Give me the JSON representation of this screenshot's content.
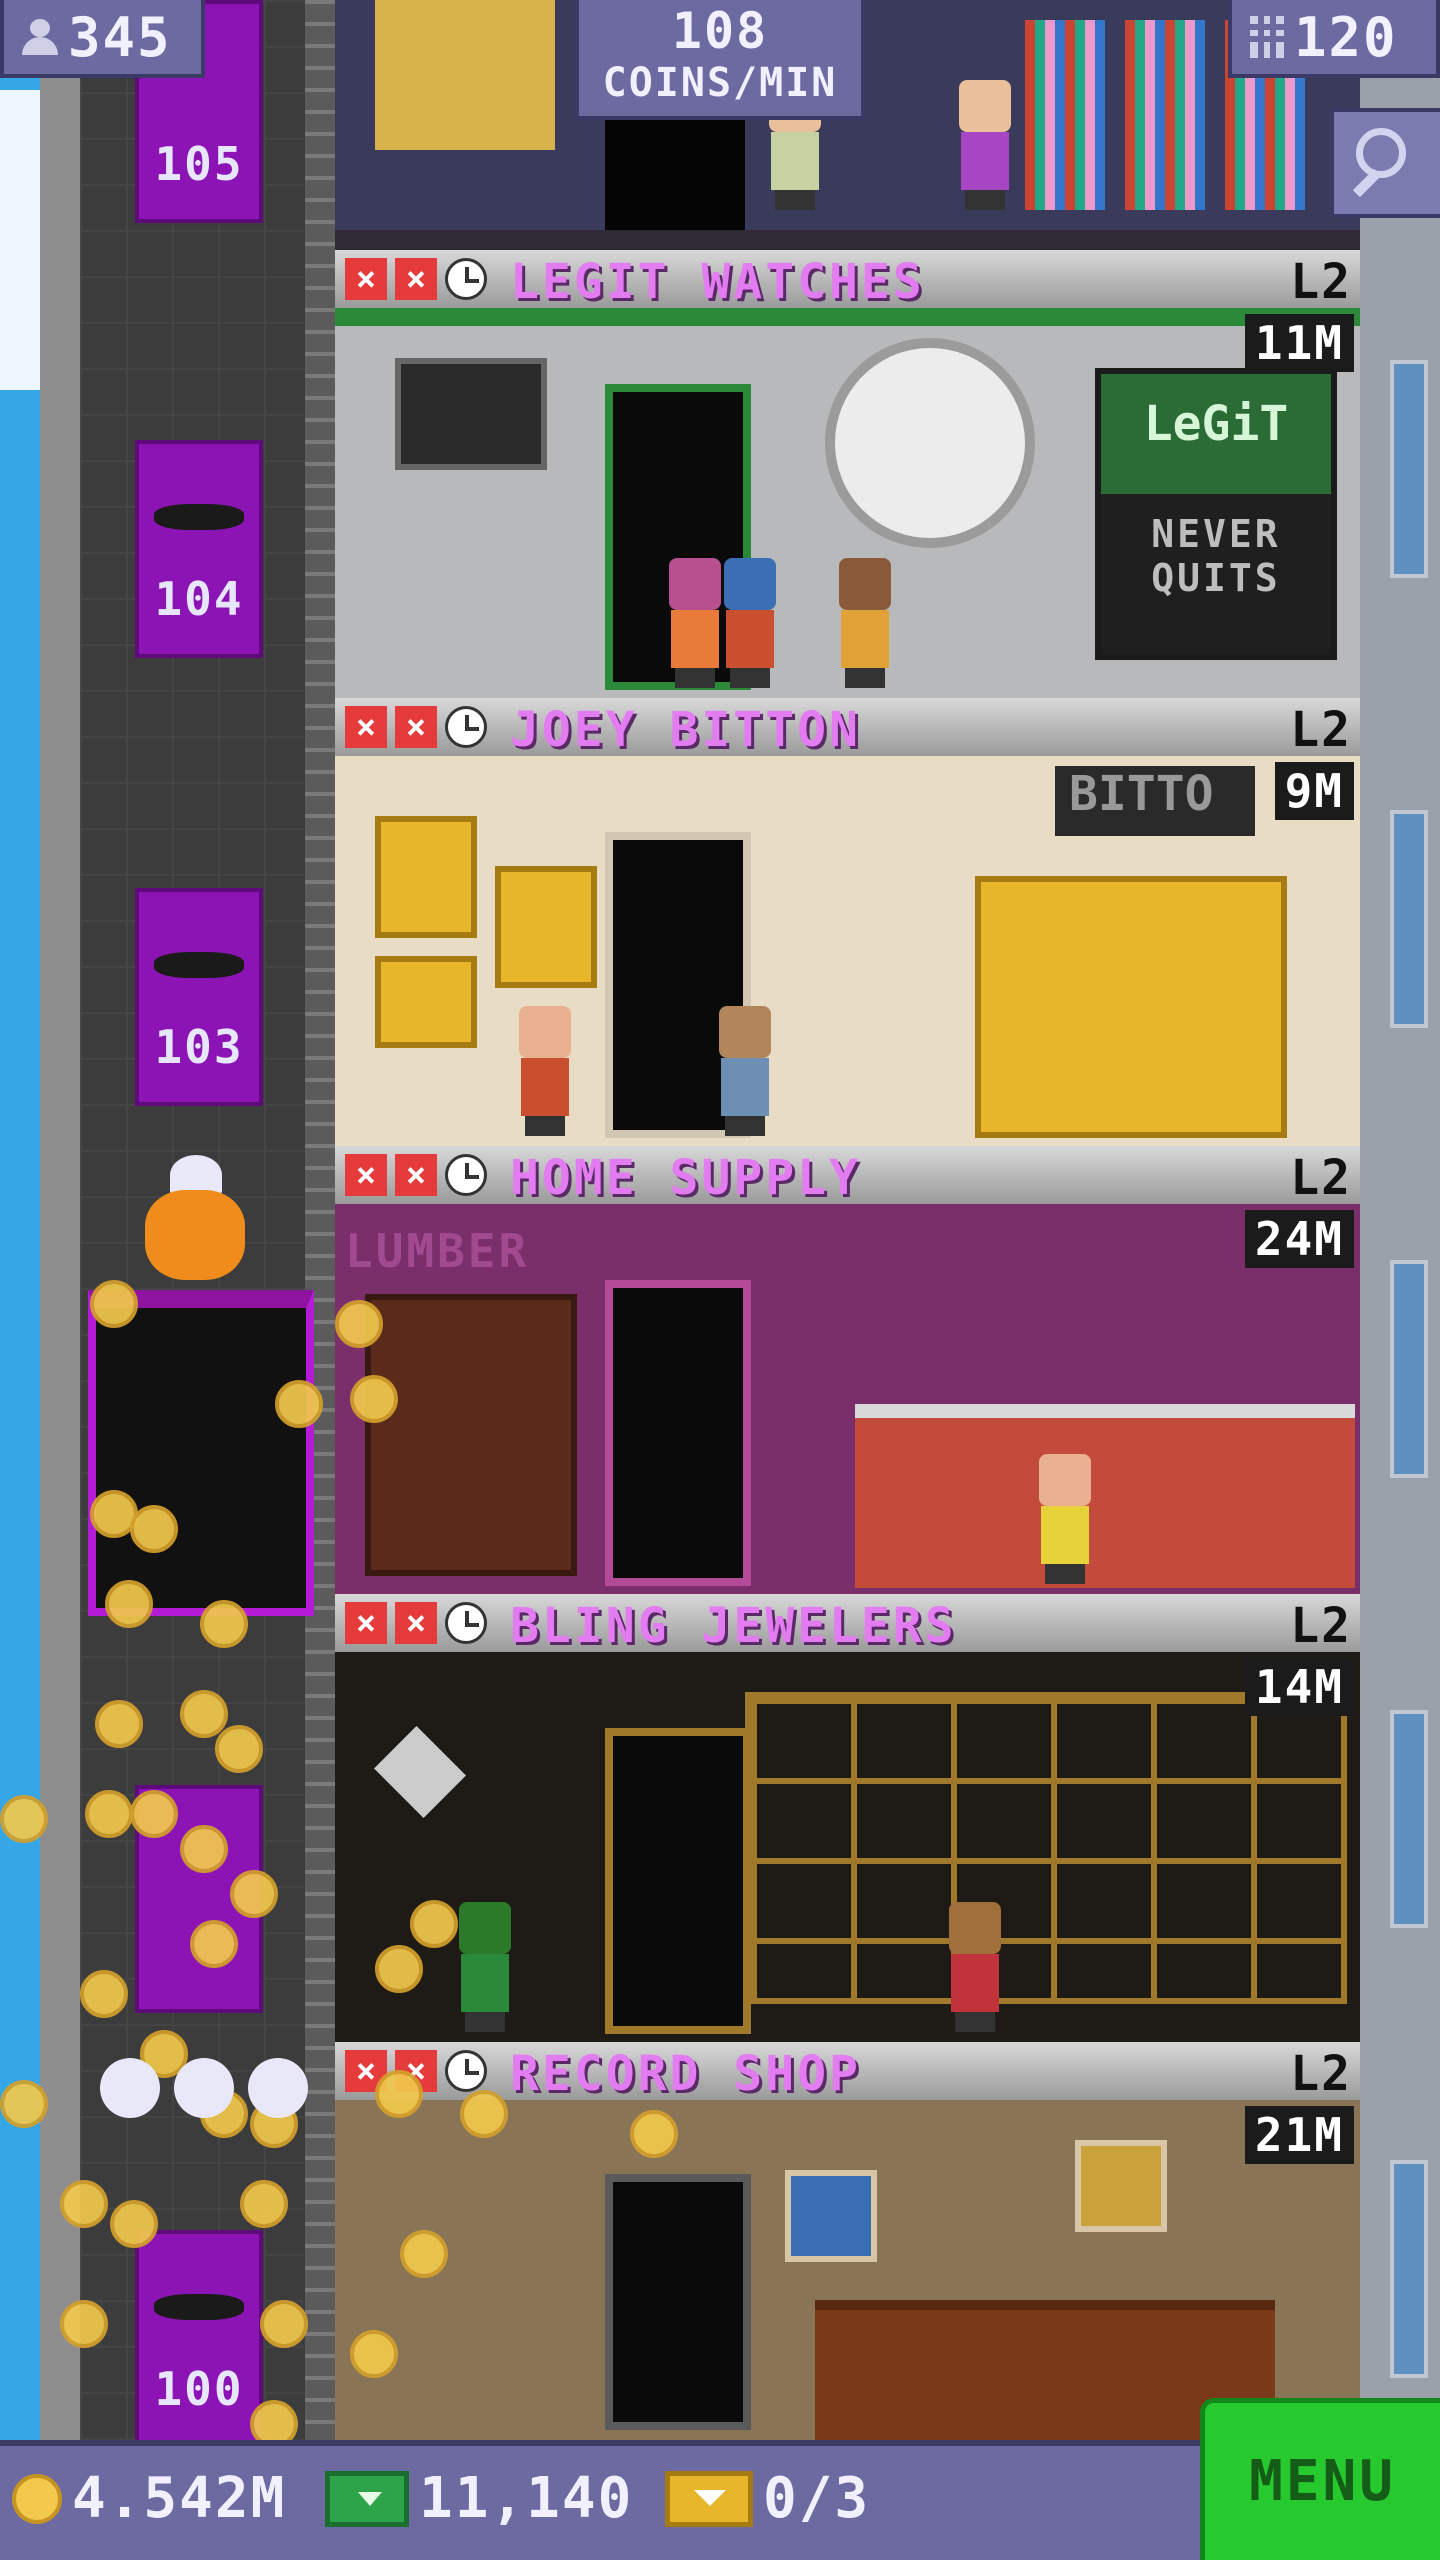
{
  "hud": {
    "population": "345",
    "coins_per_min_value": "108",
    "coins_per_min_unit": "COINS/MIN",
    "floor_count": "120",
    "zoom_icon": "magnifier-icon"
  },
  "elevator": {
    "floor_labels": [
      "105",
      "104",
      "103",
      "100"
    ]
  },
  "floors": [
    {
      "name": "LEGIT WATCHES",
      "level": "L2",
      "stock": "11M",
      "sign_line1": "LeGiT",
      "sign_line2": "NEVER",
      "sign_line3": "QUITS"
    },
    {
      "name": "JOEY BITTON",
      "level": "L2",
      "stock": "9M",
      "sign_line1": "BITTO"
    },
    {
      "name": "HOME SUPPLY",
      "level": "L2",
      "stock": "24M",
      "sign_line1": "LUMBER"
    },
    {
      "name": "BLING JEWELERS",
      "level": "L2",
      "stock": "14M"
    },
    {
      "name": "RECORD SHOP",
      "level": "L2",
      "stock": "21M"
    }
  ],
  "bottom": {
    "coins": "4.542M",
    "bux": "11,140",
    "tickets": "0/3",
    "menu_label": "MENU"
  },
  "colors": {
    "hud_bg": "#6c6aa0",
    "floor_name": "#e27cf0",
    "elevator": "#8c14b5",
    "menu_green": "#26c92e",
    "coin_gold": "#f2c94c"
  }
}
